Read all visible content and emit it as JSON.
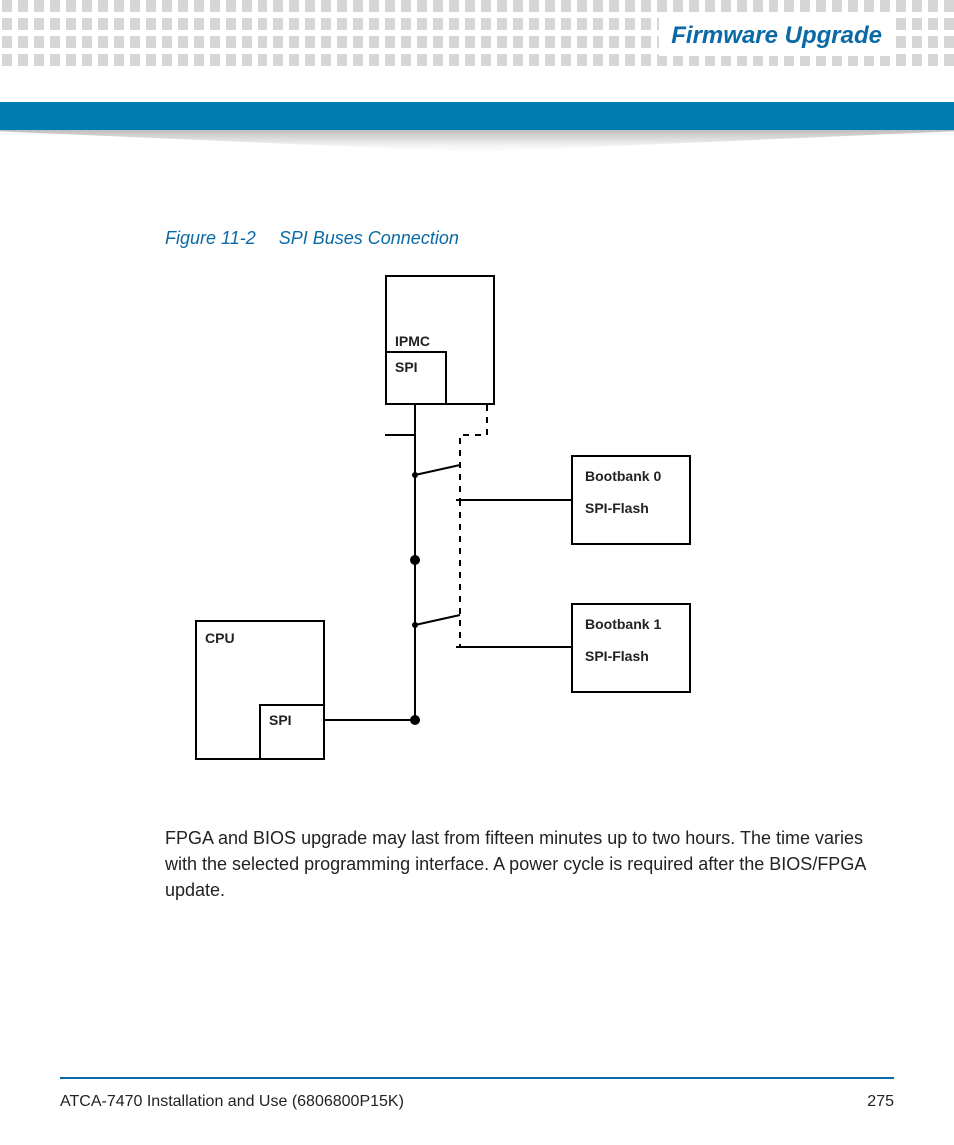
{
  "header": {
    "title": "Firmware Upgrade"
  },
  "figure": {
    "number": "Figure 11-2",
    "title": "SPI Buses Connection",
    "labels": {
      "ipmc": "IPMC",
      "ipmc_sub": "SPI",
      "cpu": "CPU",
      "cpu_sub": "SPI",
      "bb0_line1": "Bootbank 0",
      "bb0_line2": "SPI-Flash",
      "bb1_line1": "Bootbank 1",
      "bb1_line2": "SPI-Flash"
    }
  },
  "body": {
    "paragraph": "FPGA and BIOS upgrade may last from fifteen minutes up to two hours. The time varies with the selected programming interface. A power cycle is required after the BIOS/FPGA update."
  },
  "footer": {
    "left": "ATCA-7470 Installation and Use (6806800P15K)",
    "page": "275"
  }
}
